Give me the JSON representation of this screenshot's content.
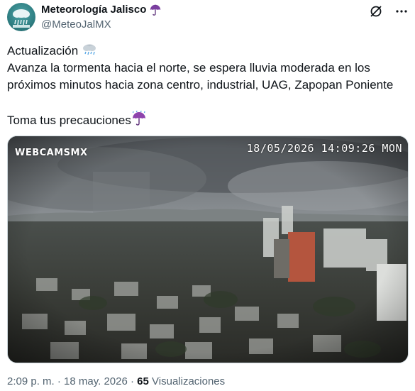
{
  "author": {
    "display_name": "Meteorología Jalisco",
    "handle": "@MeteoJalMX",
    "name_emoji_icon": "umbrella-icon"
  },
  "tweet": {
    "lines": [
      "Actualización",
      "Avanza la tormenta hacia el norte, se espera lluvia moderada en los",
      "próximos minutos hacia zona centro, industrial, UAG, Zapopan Poniente",
      "",
      "Toma tus precauciones"
    ],
    "line1_emoji_icon": "rain-cloud-icon",
    "line5_emoji_icon": "umbrella-rain-icon"
  },
  "media": {
    "logo_text": "WEBCAMSMX",
    "timestamp_text": "18/05/2026 14:09:26 MON"
  },
  "meta": {
    "time": "2:09 p. m.",
    "separator": "·",
    "date": "18 may. 2026",
    "views_count": "65",
    "views_label": "Visualizaciones"
  },
  "colors": {
    "text_primary": "#0f1419",
    "text_secondary": "#536471",
    "border": "#cfd9de",
    "umbrella": "#7b3fa0"
  },
  "icons": [
    "umbrella-icon",
    "grok-icon",
    "more-icon",
    "rain-cloud-icon",
    "umbrella-rain-icon"
  ]
}
